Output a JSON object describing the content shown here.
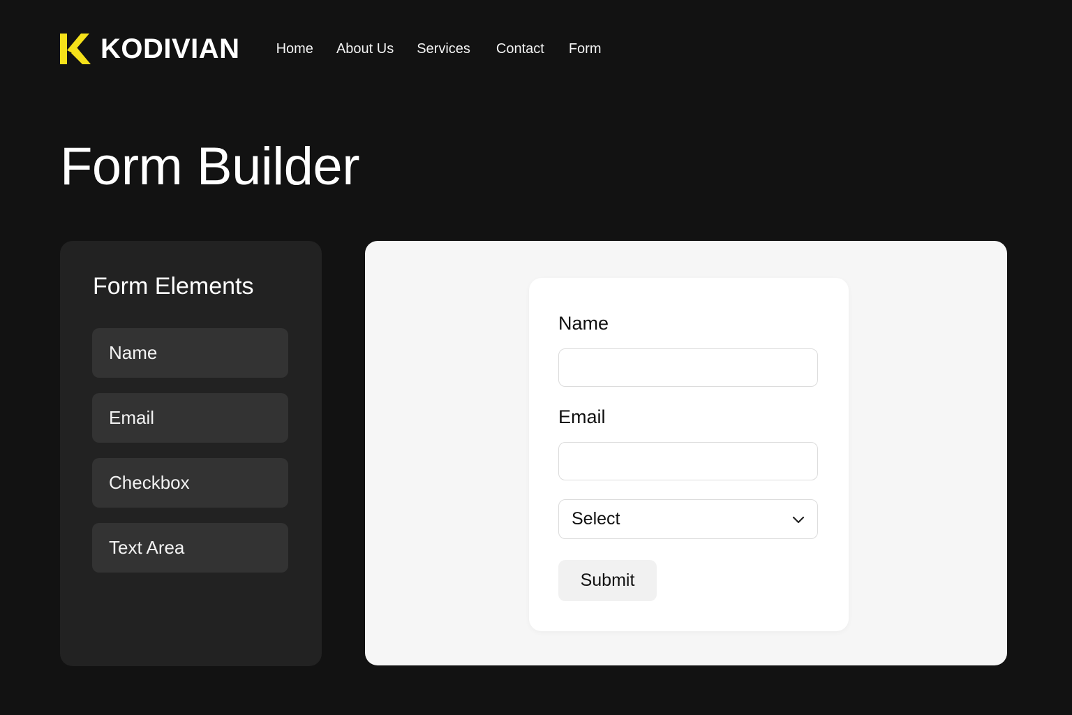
{
  "brand": {
    "logo_letter": "K",
    "name": "KODIVIAN",
    "accent_color": "#F5E11A"
  },
  "nav": {
    "items": [
      {
        "label": "Home"
      },
      {
        "label": "About Us"
      },
      {
        "label": "Services"
      },
      {
        "label": "Contact"
      },
      {
        "label": "Form"
      }
    ]
  },
  "page": {
    "title": "Form Builder"
  },
  "elements_panel": {
    "title": "Form Elements",
    "items": [
      {
        "label": "Name"
      },
      {
        "label": "Email"
      },
      {
        "label": "Checkbox"
      },
      {
        "label": "Text Area"
      }
    ]
  },
  "form_preview": {
    "name_label": "Name",
    "name_value": "",
    "email_label": "Email",
    "email_value": "",
    "select_value": "Select",
    "submit_label": "Submit"
  }
}
